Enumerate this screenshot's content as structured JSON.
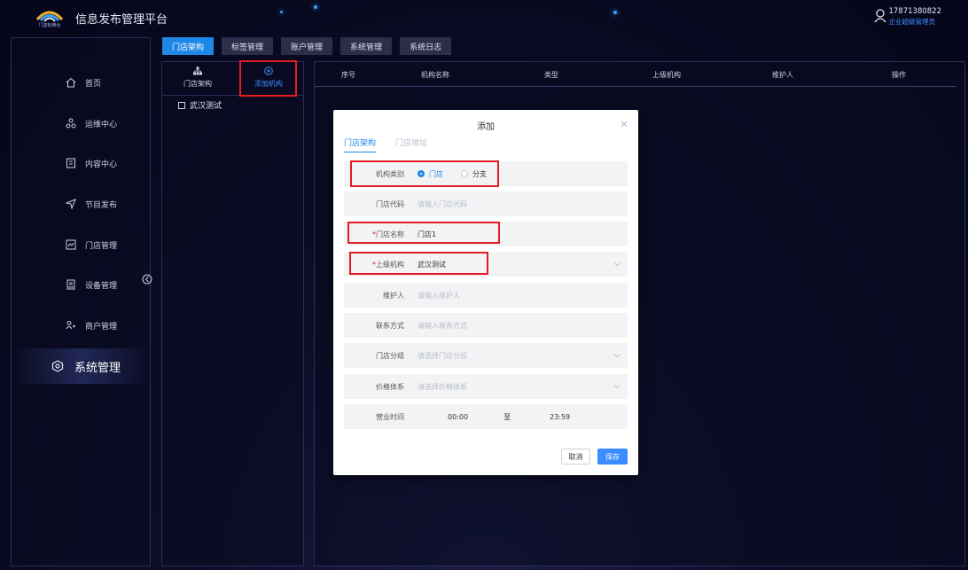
{
  "header": {
    "logo_text": "门店标牌台",
    "title": "信息发布管理平台",
    "user_phone": "17871380822",
    "user_role": "企业超级管理员"
  },
  "sidebar": {
    "items": [
      {
        "label": "首页",
        "icon": "home-icon"
      },
      {
        "label": "运维中心",
        "icon": "ops-icon"
      },
      {
        "label": "内容中心",
        "icon": "content-icon"
      },
      {
        "label": "节目发布",
        "icon": "send-icon"
      },
      {
        "label": "门店管理",
        "icon": "store-icon"
      },
      {
        "label": "设备管理",
        "icon": "device-icon"
      },
      {
        "label": "商户管理",
        "icon": "merchant-icon"
      },
      {
        "label": "系统管理",
        "icon": "system-icon",
        "active": true
      }
    ]
  },
  "tabs": [
    {
      "label": "门店架构",
      "active": true
    },
    {
      "label": "标签管理"
    },
    {
      "label": "账户管理"
    },
    {
      "label": "系统管理"
    },
    {
      "label": "系统日志"
    }
  ],
  "tree": {
    "structure_label": "门店架构",
    "add_label": "添加机构",
    "nodes": [
      {
        "label": "武汉测试"
      }
    ]
  },
  "table": {
    "columns": [
      "序号",
      "机构名称",
      "类型",
      "上级机构",
      "维护人",
      "操作"
    ]
  },
  "modal": {
    "title": "添加",
    "tabs": [
      {
        "label": "门店架构",
        "active": true
      },
      {
        "label": "门店地址"
      }
    ],
    "fields": {
      "type": {
        "label": "机构类别",
        "options": [
          "门店",
          "分支"
        ],
        "selected": "门店"
      },
      "code": {
        "label": "门店代码",
        "placeholder": "请输入门店代码"
      },
      "name": {
        "label": "门店名称",
        "value": "门店1",
        "required": true
      },
      "parent": {
        "label": "上级机构",
        "value": "武汉测试",
        "required": true
      },
      "maintainer": {
        "label": "维护人",
        "placeholder": "请输入维护人"
      },
      "contact": {
        "label": "联系方式",
        "placeholder": "请输入联系方式"
      },
      "group": {
        "label": "门店分组",
        "placeholder": "请选择门店分组"
      },
      "price": {
        "label": "价格体系",
        "placeholder": "请选择价格体系"
      },
      "hours": {
        "label": "营业时间",
        "start": "00:00",
        "sep": "至",
        "end": "23:59"
      }
    },
    "cancel_label": "取消",
    "save_label": "保存"
  },
  "colors": {
    "accent": "#1f87e6",
    "highlight": "#e31b23"
  }
}
